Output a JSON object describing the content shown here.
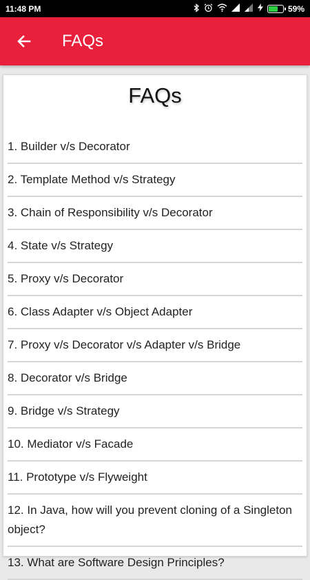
{
  "status_bar": {
    "time": "11:48 PM",
    "battery_percent": "59%",
    "battery_level": 0.59,
    "icons": [
      "bluetooth-icon",
      "alarm-icon",
      "wifi-icon",
      "signal-icon",
      "signal-icon",
      "charging-icon",
      "battery-icon"
    ]
  },
  "app_bar": {
    "title": "FAQs",
    "background": "#e8203c"
  },
  "card": {
    "title": "FAQs",
    "items": [
      "1. Builder v/s Decorator",
      "2. Template Method v/s Strategy",
      "3. Chain of Responsibility v/s Decorator",
      "4. State v/s Strategy",
      "5. Proxy v/s Decorator",
      "6. Class Adapter v/s Object Adapter",
      "7. Proxy v/s Decorator v/s Adapter v/s Bridge",
      "8. Decorator v/s Bridge",
      "9. Bridge v/s Strategy",
      "10. Mediator v/s Facade",
      "11. Prototype v/s Flyweight",
      "12. In Java, how will you prevent cloning of a Singleton object?",
      "13. What are Software Design Principles?"
    ]
  }
}
